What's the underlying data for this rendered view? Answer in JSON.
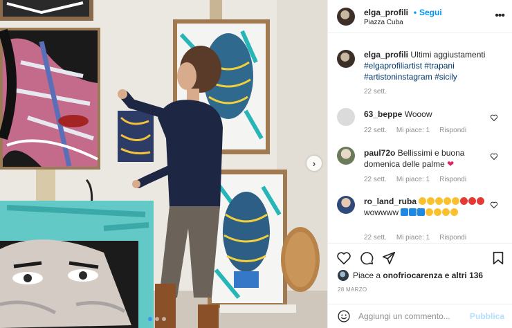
{
  "post": {
    "author": "elga_profili",
    "separator": "•",
    "follow_label": "Segui",
    "location": "Piazza Cuba",
    "more_icon": "more-horizontal-icon"
  },
  "caption": {
    "author": "elga_profili",
    "text": "Ultimi aggiustamenti",
    "hashtags": [
      "#elgaprofiliartist",
      "#trapani",
      "#artistoninstagram",
      "#sicily"
    ],
    "time": "22 sett."
  },
  "comments": [
    {
      "author": "63_beppe",
      "text": "Wooow",
      "time": "22 sett.",
      "likes": "Mi piace: 1",
      "reply": "Rispondi"
    },
    {
      "author": "paul72o",
      "text": "Bellissimi e buona domenica delle palme",
      "emoji": "red-heart",
      "time": "22 sett.",
      "likes": "Mi piace: 1",
      "reply": "Rispondi"
    },
    {
      "author": "ro_land_ruba",
      "text": "wowwww",
      "emoji_sequence": [
        "clapping-hands",
        "clapping-hands",
        "clapping-hands",
        "clapping-hands",
        "clapping-hands",
        "star-struck",
        "star-struck",
        "star-struck",
        "star-struck",
        "down-arrow",
        "down-arrow",
        "down-arrow",
        "ok-hand",
        "ok-hand",
        "thumbs-up",
        "thumbs-up"
      ],
      "time": "22 sett.",
      "likes": "Mi piace: 1",
      "reply": "Rispondi"
    }
  ],
  "actions": {
    "like_icon": "heart-icon",
    "comment_icon": "comment-bubble-icon",
    "share_icon": "paper-plane-icon",
    "save_icon": "bookmark-icon"
  },
  "likes_summary": {
    "text_prefix": "Piace a",
    "user": "onofriocarenza",
    "text_suffix": "e altri 136"
  },
  "post_date": "28 MARZO",
  "add_comment": {
    "placeholder": "Aggiungi un commento...",
    "publish_label": "Pubblica"
  },
  "carousel": {
    "total_slides": 3,
    "active_index": 0
  },
  "colors": {
    "accent": "#0095f6",
    "link": "#00376b",
    "muted": "#8e8e8e",
    "publish_disabled": "#b2dffc",
    "heart_red": "#ed4956"
  }
}
